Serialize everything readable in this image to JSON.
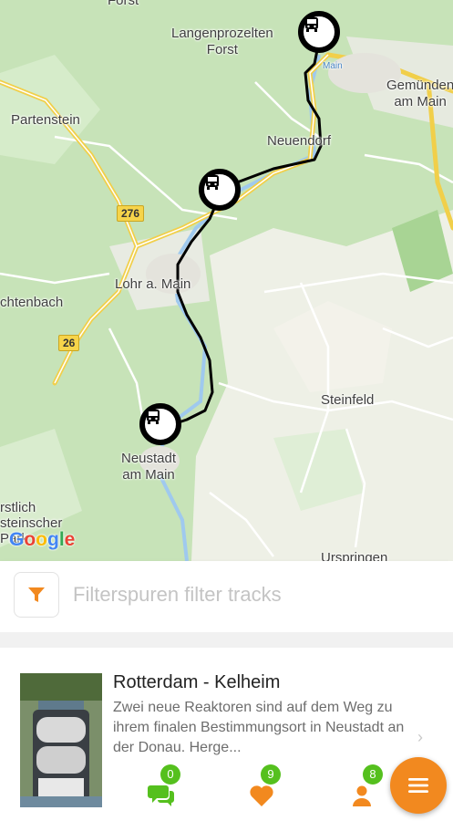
{
  "map": {
    "places": {
      "langenprozelten": "Langenprozelten Forst",
      "langenprozelten_line1": "Langenprozelten",
      "langenprozelten_line2": "Forst",
      "partenstein": "Partenstein",
      "gemuenden_line1": "Gemünden",
      "gemuenden_line2": "am Main",
      "neuendorf": "Neuendorf",
      "lohr": "Lohr a. Main",
      "htenbach": "chtenbach",
      "steinfeld": "Steinfeld",
      "neustadt_line1": "Neustadt",
      "neustadt_line2": "am Main",
      "urspringen": "Urspringen",
      "forst_partial1": "rstlich",
      "forst_partial2": "steinscher",
      "forst_partial3": "Park",
      "top_partial": "Forst",
      "river_label": "Main"
    },
    "roads": {
      "r276": "276",
      "r26": "26"
    },
    "marker_icon": "bus-icon",
    "attribution": "Google"
  },
  "filter": {
    "icon": "funnel-icon",
    "placeholder": "Filterspuren filter tracks",
    "value": ""
  },
  "track": {
    "title": "Rotterdam - Kelheim",
    "description": "Zwei neue Reaktoren sind auf dem Weg zu ihrem finalen Bestimmungsort in Neustadt an der Donau. Herge...",
    "chevron": "›",
    "stats": {
      "comments": "0",
      "likes": "9",
      "followers": "8"
    }
  },
  "colors": {
    "accent": "#f2891f",
    "badge": "#55c01e",
    "route": "#000000",
    "road_major": "#f6d44a"
  }
}
